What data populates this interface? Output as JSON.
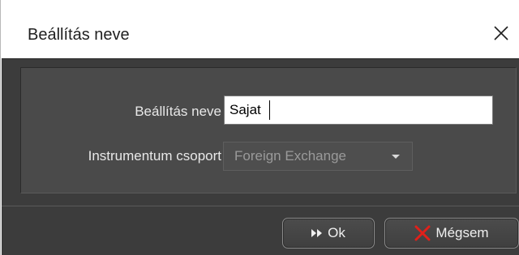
{
  "dialog": {
    "title": "Beállítás neve",
    "close_icon": "close-icon"
  },
  "form": {
    "name_label": "Beállítás neve",
    "name_value": "Sajat",
    "group_label": "Instrumentum csoport",
    "group_selected": "Foreign Exchange"
  },
  "footer": {
    "ok_label": "Ok",
    "ok_icon": "fast-forward-icon",
    "cancel_label": "Mégsem",
    "cancel_icon": "red-x-icon"
  },
  "colors": {
    "panel_bg": "#3c3c3c",
    "inner_bg": "#4a4a4a",
    "cancel_x": "#e0201a"
  }
}
